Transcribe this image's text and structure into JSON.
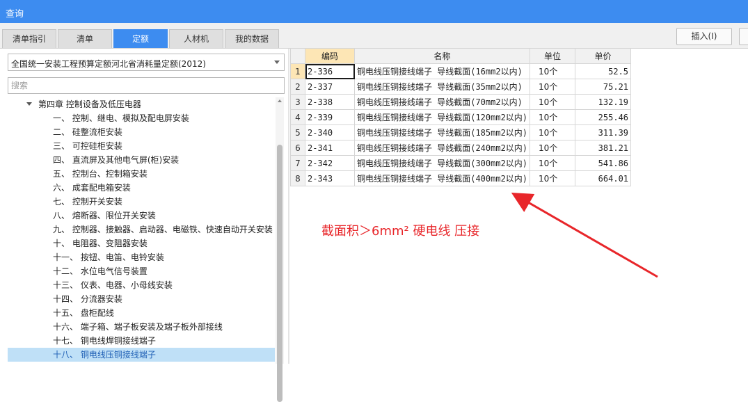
{
  "window": {
    "title": "查询"
  },
  "tabs": [
    {
      "label": "清单指引",
      "active": false
    },
    {
      "label": "清单",
      "active": false
    },
    {
      "label": "定额",
      "active": true
    },
    {
      "label": "人材机",
      "active": false
    },
    {
      "label": "我的数据",
      "active": false
    }
  ],
  "toolbar": {
    "insert_label": "插入(I)"
  },
  "library": {
    "selected": "全国统一安装工程预算定额河北省消耗量定额(2012)"
  },
  "search": {
    "placeholder": "搜索"
  },
  "tree": {
    "parent": "第四章 控制设备及低压电器",
    "children": [
      {
        "label": "一、 控制、继电、模拟及配电屏安装",
        "selected": false
      },
      {
        "label": "二、 硅整流柜安装",
        "selected": false
      },
      {
        "label": "三、 可控硅柜安装",
        "selected": false
      },
      {
        "label": "四、 直流屏及其他电气屏(柜)安装",
        "selected": false
      },
      {
        "label": "五、 控制台、控制箱安装",
        "selected": false
      },
      {
        "label": "六、 成套配电箱安装",
        "selected": false
      },
      {
        "label": "七、 控制开关安装",
        "selected": false
      },
      {
        "label": "八、 熔断器、限位开关安装",
        "selected": false
      },
      {
        "label": "九、 控制器、接触器、启动器、电磁铁、快速自动开关安装",
        "selected": false
      },
      {
        "label": "十、 电阻器、变阻器安装",
        "selected": false
      },
      {
        "label": "十一、 按钮、电笛、电铃安装",
        "selected": false
      },
      {
        "label": "十二、 水位电气信号装置",
        "selected": false
      },
      {
        "label": "十三、 仪表、电器、小母线安装",
        "selected": false
      },
      {
        "label": "十四、 分流器安装",
        "selected": false
      },
      {
        "label": "十五、 盘柜配线",
        "selected": false
      },
      {
        "label": "十六、 端子箱、端子板安装及端子板外部接线",
        "selected": false
      },
      {
        "label": "十七、 铜电线焊铜接线端子",
        "selected": false
      },
      {
        "label": "十八、 铜电线压铜接线端子",
        "selected": true
      }
    ]
  },
  "table": {
    "headers": {
      "code": "编码",
      "name": "名称",
      "unit": "单位",
      "price": "单价"
    },
    "rows": [
      {
        "n": "1",
        "code": "2-336",
        "name": "铜电线压铜接线端子 导线截面(16mm2以内)",
        "unit": "10个",
        "price": "52.5"
      },
      {
        "n": "2",
        "code": "2-337",
        "name": "铜电线压铜接线端子 导线截面(35mm2以内)",
        "unit": "10个",
        "price": "75.21"
      },
      {
        "n": "3",
        "code": "2-338",
        "name": "铜电线压铜接线端子 导线截面(70mm2以内)",
        "unit": "10个",
        "price": "132.19"
      },
      {
        "n": "4",
        "code": "2-339",
        "name": "铜电线压铜接线端子 导线截面(120mm2以内)",
        "unit": "10个",
        "price": "255.46"
      },
      {
        "n": "5",
        "code": "2-340",
        "name": "铜电线压铜接线端子 导线截面(185mm2以内)",
        "unit": "10个",
        "price": "311.39"
      },
      {
        "n": "6",
        "code": "2-341",
        "name": "铜电线压铜接线端子 导线截面(240mm2以内)",
        "unit": "10个",
        "price": "381.21"
      },
      {
        "n": "7",
        "code": "2-342",
        "name": "铜电线压铜接线端子 导线截面(300mm2以内)",
        "unit": "10个",
        "price": "541.86"
      },
      {
        "n": "8",
        "code": "2-343",
        "name": "铜电线压铜接线端子 导线截面(400mm2以内)",
        "unit": "10个",
        "price": "664.01"
      }
    ]
  },
  "annotation": {
    "text": "截面积＞6mm²  硬电线 压接",
    "color": "#e8262a"
  },
  "colors": {
    "titlebar": "#3d8cf0",
    "active_tab": "#3d8cf0",
    "selected_row": "#bfe0f7",
    "header_highlight": "#fde6b5"
  }
}
